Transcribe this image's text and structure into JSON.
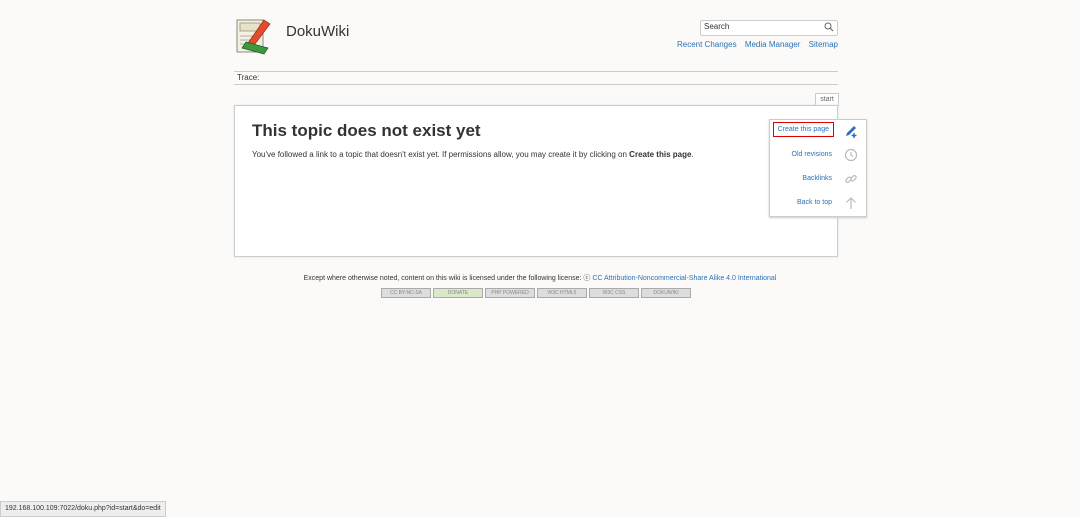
{
  "site": {
    "name": "DokuWiki"
  },
  "search": {
    "placeholder": "Search"
  },
  "usertools": {
    "recent_changes": "Recent Changes",
    "media_manager": "Media Manager",
    "sitemap": "Sitemap"
  },
  "trace": {
    "label": "Trace:"
  },
  "tab": {
    "label": "start"
  },
  "page": {
    "title": "This topic does not exist yet",
    "text_prefix": "You've followed a link to a topic that doesn't exist yet. If permissions allow, you may create it by clicking on ",
    "text_bold": "Create this page",
    "text_suffix": "."
  },
  "pagetools": {
    "create": "Create this page",
    "old_revisions": "Old revisions",
    "backlinks": "Backlinks",
    "back_to_top": "Back to top"
  },
  "footer": {
    "license_text": "Except where otherwise noted, content on this wiki is licensed under the following license:",
    "license_link": "CC Attribution-Noncommercial-Share Alike 4.0 International",
    "badges": [
      "CC BY-NC-SA",
      "DONATE",
      "PHP POWERED",
      "W3C HTML5",
      "W3C CSS",
      "DOKUWIKI"
    ]
  },
  "statusbar": {
    "url": "192.168.100.109:7022/doku.php?id=start&do=edit"
  }
}
